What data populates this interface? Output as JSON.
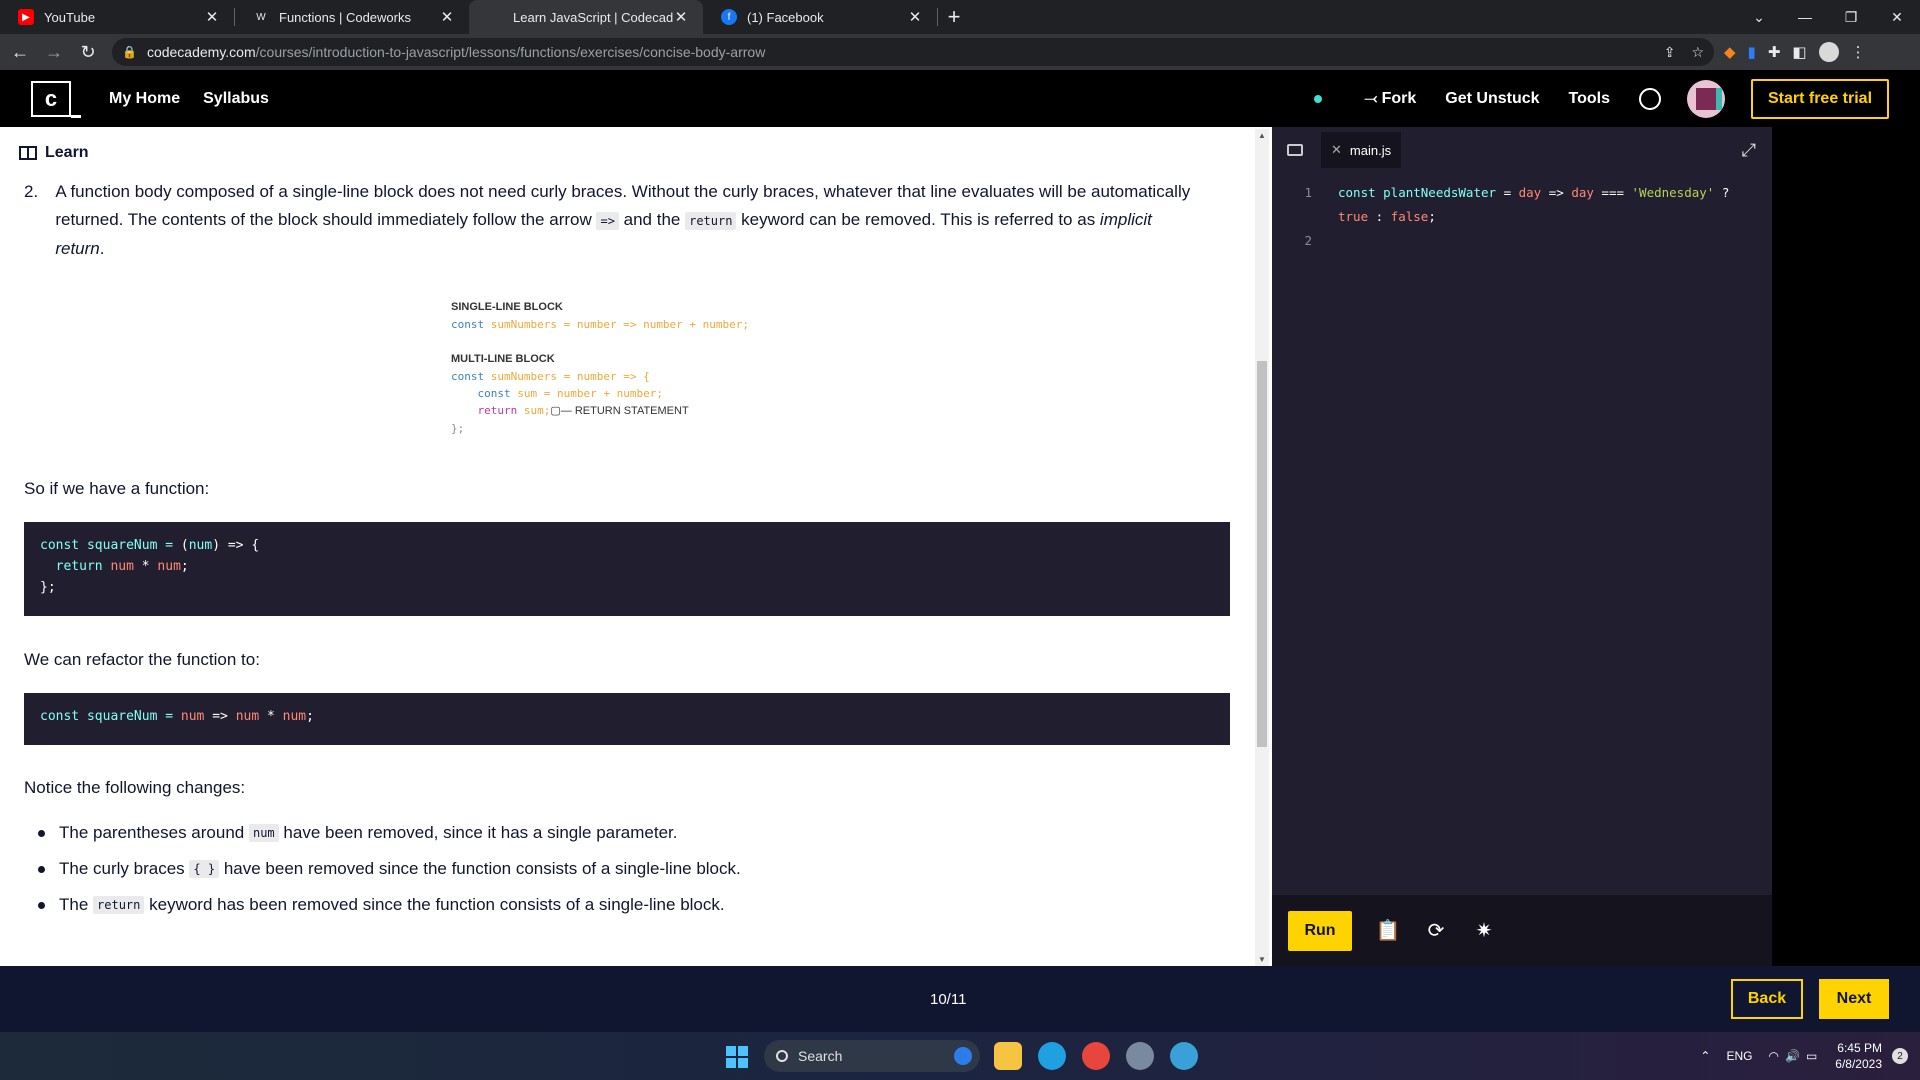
{
  "browser": {
    "tabs": [
      {
        "title": "YouTube",
        "icon": "youtube-icon",
        "active": false
      },
      {
        "title": "Functions | Codeworks",
        "icon": "codeworks-icon",
        "active": false
      },
      {
        "title": "Learn JavaScript | Codecademy",
        "icon": "codecademy-icon",
        "active": true
      },
      {
        "title": "(1) Facebook",
        "icon": "facebook-icon",
        "active": false
      }
    ],
    "url_domain": "codecademy.com",
    "url_path": "/courses/introduction-to-javascript/lessons/functions/exercises/concise-body-arrow"
  },
  "header": {
    "nav": [
      "My Home",
      "Syllabus"
    ],
    "fork_label": "Fork",
    "unstuck_label": "Get Unstuck",
    "tools_label": "Tools",
    "trial_label": "Start free trial"
  },
  "learn": {
    "pane_title": "Learn",
    "item_number": "2.",
    "item_text_1": "A function body composed of a single-line block does not need curly braces. Without the curly braces, whatever that line evaluates will be automatically returned. The contents of the block should immediately follow the arrow ",
    "item_code_arrow": "=>",
    "item_text_2": " and the ",
    "item_code_return": "return",
    "item_text_3": " keyword can be removed. This is referred to as ",
    "item_text_italic_1": "implicit",
    "item_text_italic_2": "return",
    "item_text_4": ".",
    "diagram": {
      "single_header": "SINGLE-LINE BLOCK",
      "multi_header": "MULTI-LINE BLOCK",
      "annotation": "RETURN STATEMENT"
    },
    "para1": "So if we have a function:",
    "para2": "We can refactor the function to:",
    "para3": "Notice the following changes:",
    "bullets": [
      {
        "pre": "The parentheses around ",
        "code": "num",
        "post": " have been removed, since it has a single parameter."
      },
      {
        "pre": "The curly braces ",
        "code": "{ }",
        "post": " have been removed since the function consists of a single-line block."
      },
      {
        "pre": "The ",
        "code": "return",
        "post": " keyword has been removed since the function consists of a single-line block."
      }
    ]
  },
  "editor": {
    "filename": "main.js",
    "line_numbers": [
      "1",
      "2"
    ],
    "run_label": "Run"
  },
  "footer": {
    "progress": "10/11",
    "back_label": "Back",
    "next_label": "Next"
  },
  "taskbar": {
    "search_placeholder": "Search",
    "lang": "ENG",
    "time": "6:45 PM",
    "date": "6/8/2023",
    "notification_count": "2"
  }
}
